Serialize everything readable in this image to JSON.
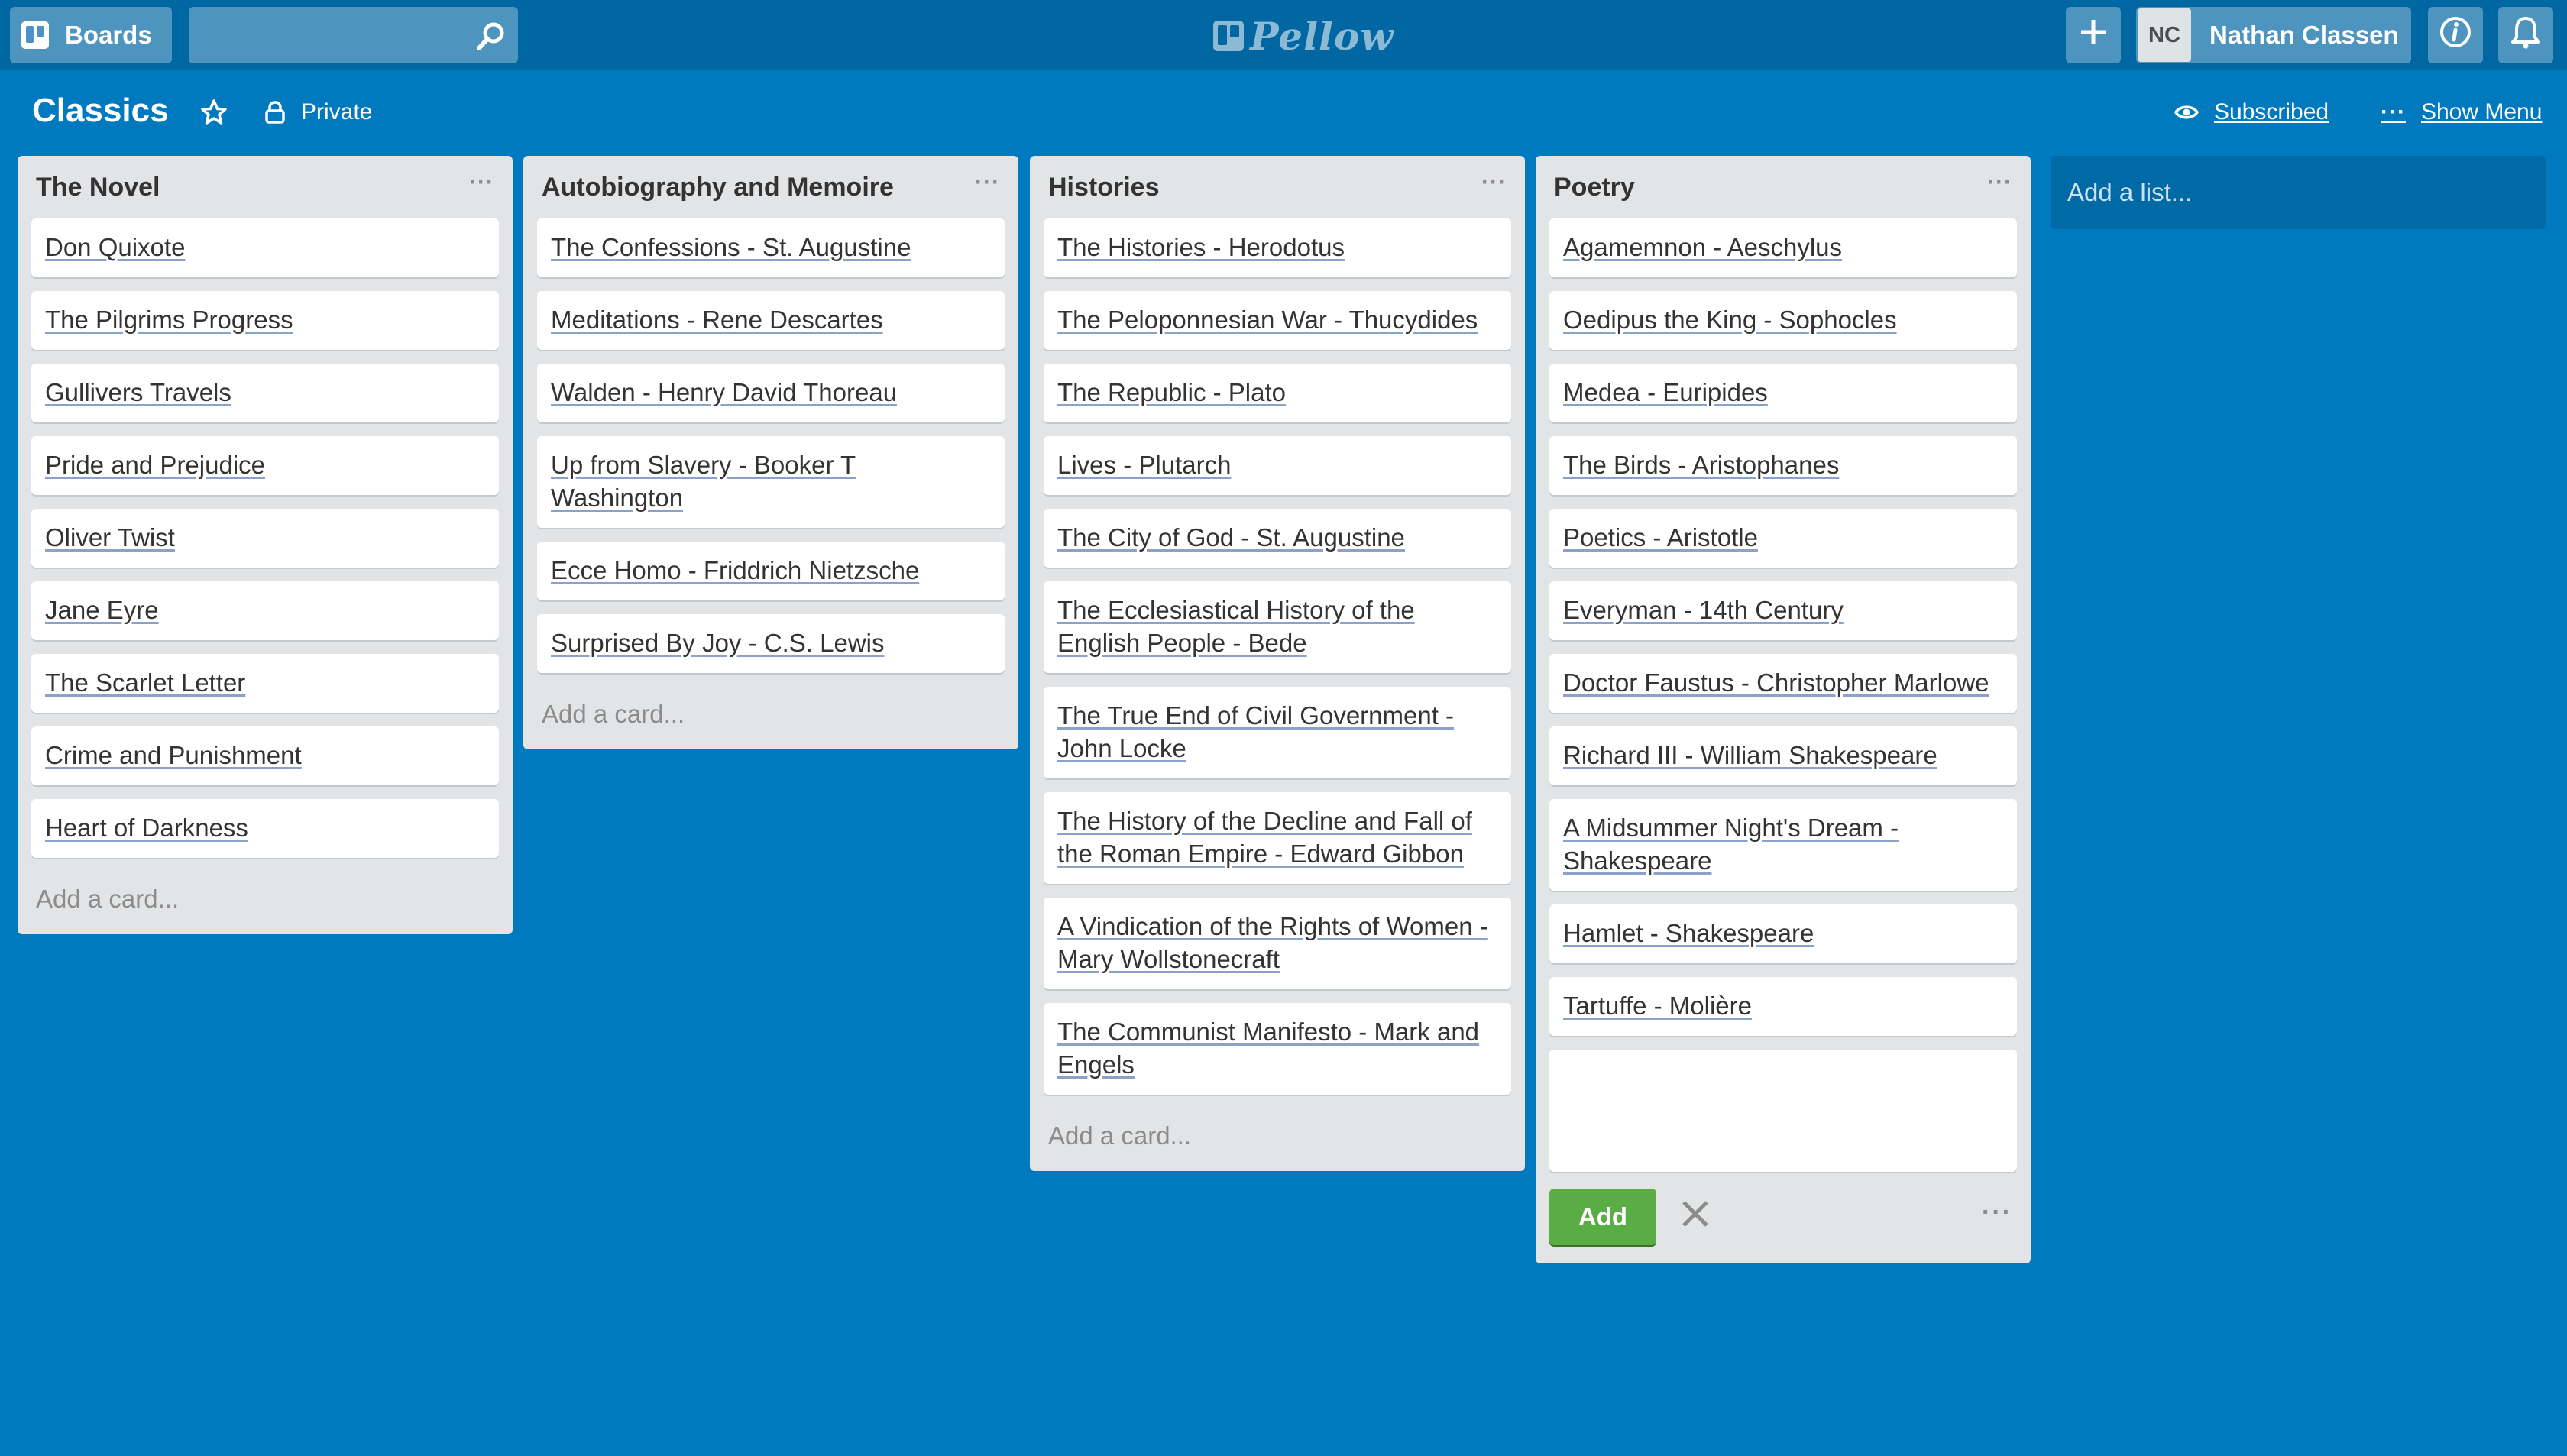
{
  "header": {
    "boards_label": "Boards",
    "search_value": "",
    "logo_text": "Pellow",
    "user_initials": "NC",
    "user_name": "Nathan Classen"
  },
  "board": {
    "title": "Classics",
    "visibility": "Private",
    "subscribed_label": "Subscribed",
    "show_menu_label": "Show Menu",
    "more_glyph": "···"
  },
  "lists": [
    {
      "title": "The Novel",
      "cards": [
        "Don Quixote",
        "The Pilgrims Progress",
        "Gullivers Travels",
        "Pride and Prejudice",
        "Oliver Twist",
        "Jane Eyre",
        "The Scarlet Letter",
        "Crime and Punishment",
        "Heart of Darkness"
      ],
      "add_card_label": "Add a card..."
    },
    {
      "title": "Autobiography and Memoire",
      "cards": [
        "The Confessions - St. Augustine",
        "Meditations - Rene Descartes",
        "Walden - Henry David Thoreau",
        "Up from Slavery - Booker T Washington",
        "Ecce Homo - Friddrich Nietzsche",
        "Surprised By Joy - C.S. Lewis"
      ],
      "add_card_label": "Add a card..."
    },
    {
      "title": "Histories",
      "cards": [
        "The Histories - Herodotus",
        "The Peloponnesian War - Thucydides",
        "The Republic - Plato",
        "Lives - Plutarch",
        "The City of God - St. Augustine",
        "The Ecclesiastical History of the English People - Bede",
        "The True End of Civil Government - John Locke",
        "The History of the Decline and Fall of the Roman Empire - Edward Gibbon",
        "A Vindication of the Rights of Women - Mary Wollstonecraft",
        "The Communist Manifesto - Mark and Engels"
      ],
      "add_card_label": "Add a card..."
    },
    {
      "title": "Poetry",
      "cards": [
        "Agamemnon - Aeschylus",
        "Oedipus the King - Sophocles",
        "Medea - Euripides",
        "The Birds - Aristophanes",
        "Poetics - Aristotle",
        "Everyman - 14th Century",
        "Doctor Faustus - Christopher Marlowe",
        "Richard III - William Shakespeare",
        "A Midsummer Night's Dream - Shakespeare",
        "Hamlet - Shakespeare",
        "Tartuffe - Molière"
      ],
      "composer": {
        "add_label": "Add"
      }
    }
  ],
  "add_list_placeholder": "Add a list...",
  "colors": {
    "board_bg": "#0079bf",
    "header_bg": "#0067a3",
    "list_bg": "#e2e4e6",
    "add_button": "#5aac44"
  },
  "icons": [
    "boards-icon",
    "search-icon",
    "pellow-logo-icon",
    "plus-icon",
    "info-icon",
    "bell-icon",
    "star-icon",
    "lock-icon",
    "eye-icon",
    "close-icon"
  ]
}
